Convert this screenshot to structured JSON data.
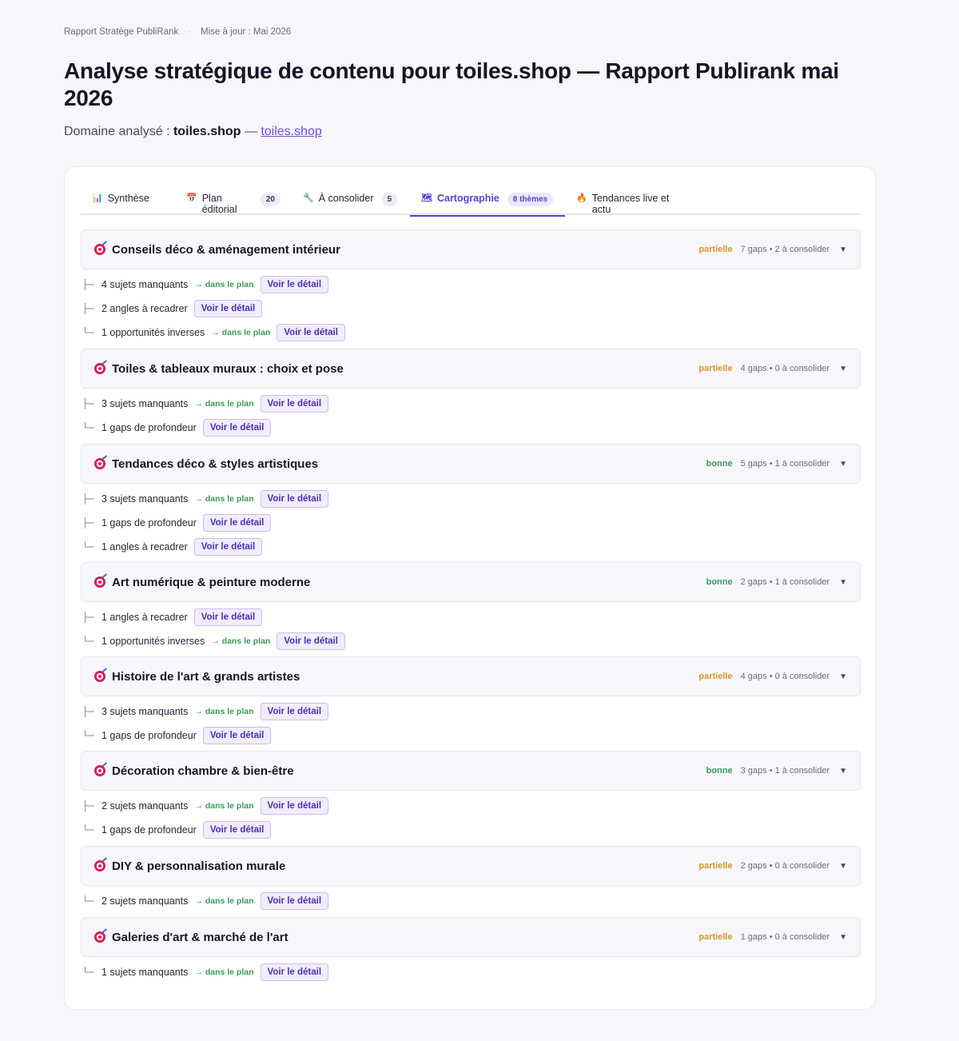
{
  "header": {
    "report_name": "Rapport Stratège PubliRank",
    "separator": "·",
    "updated": "Mise à jour : Mai 2026",
    "title": "Analyse stratégique de contenu pour toiles.shop — Rapport Publirank mai 2026",
    "domain_label": "Domaine analysé :",
    "domain_name": "toiles.shop",
    "domain_dash": "—",
    "domain_link": "toiles.shop"
  },
  "tabs": [
    {
      "icon": "📊",
      "label": "Synthèse",
      "badge": ""
    },
    {
      "icon": "📅",
      "label": "Plan éditorial",
      "badge": "20"
    },
    {
      "icon": "🔧",
      "label": "À consolider",
      "badge": "5"
    },
    {
      "icon": "🗺",
      "label": "Cartographie",
      "badge": "8 thèmes"
    },
    {
      "icon": "🔥",
      "label": "Tendances live et actu",
      "badge": ""
    }
  ],
  "common": {
    "in_plan": "→ dans le plan",
    "detail": "Voir le détail"
  },
  "themes": [
    {
      "title": "Conseils déco & aménagement intérieur",
      "status": "partielle",
      "stats": "7 gaps • 2 à consolider",
      "rows": [
        {
          "text": "4 sujets manquants",
          "plan": true
        },
        {
          "text": "2 angles à recadrer",
          "plan": false
        },
        {
          "text": "1 opportunités inverses",
          "plan": true
        }
      ]
    },
    {
      "title": "Toiles & tableaux muraux : choix et pose",
      "status": "partielle",
      "stats": "4 gaps • 0 à consolider",
      "rows": [
        {
          "text": "3 sujets manquants",
          "plan": true
        },
        {
          "text": "1 gaps de profondeur",
          "plan": false
        }
      ]
    },
    {
      "title": "Tendances déco & styles artistiques",
      "status": "bonne",
      "stats": "5 gaps • 1 à consolider",
      "rows": [
        {
          "text": "3 sujets manquants",
          "plan": true
        },
        {
          "text": "1 gaps de profondeur",
          "plan": false
        },
        {
          "text": "1 angles à recadrer",
          "plan": false
        }
      ]
    },
    {
      "title": "Art numérique & peinture moderne",
      "status": "bonne",
      "stats": "2 gaps • 1 à consolider",
      "rows": [
        {
          "text": "1 angles à recadrer",
          "plan": false
        },
        {
          "text": "1 opportunités inverses",
          "plan": true
        }
      ]
    },
    {
      "title": "Histoire de l'art & grands artistes",
      "status": "partielle",
      "stats": "4 gaps • 0 à consolider",
      "rows": [
        {
          "text": "3 sujets manquants",
          "plan": true
        },
        {
          "text": "1 gaps de profondeur",
          "plan": false
        }
      ]
    },
    {
      "title": "Décoration chambre & bien-être",
      "status": "bonne",
      "stats": "3 gaps • 1 à consolider",
      "rows": [
        {
          "text": "2 sujets manquants",
          "plan": true
        },
        {
          "text": "1 gaps de profondeur",
          "plan": false
        }
      ]
    },
    {
      "title": "DIY & personnalisation murale",
      "status": "partielle",
      "stats": "2 gaps • 0 à consolider",
      "rows": [
        {
          "text": "2 sujets manquants",
          "plan": true
        }
      ]
    },
    {
      "title": "Galeries d'art & marché de l'art",
      "status": "partielle",
      "stats": "1 gaps • 0 à consolider",
      "rows": [
        {
          "text": "1 sujets manquants",
          "plan": true
        }
      ]
    }
  ]
}
